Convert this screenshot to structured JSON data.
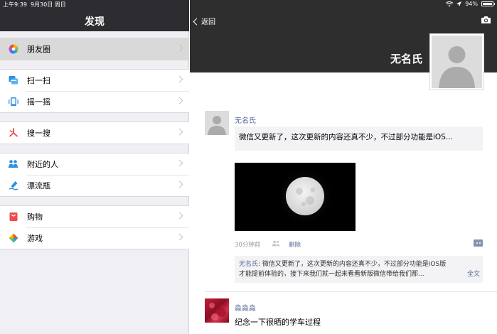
{
  "status_bar": {
    "time": "上午9:39",
    "date": "9月30日 周日",
    "battery": "94%"
  },
  "left_panel": {
    "title": "发现",
    "groups": [
      [
        {
          "label": "朋友圈",
          "icon": "moments-icon",
          "selected": true
        }
      ],
      [
        {
          "label": "扫一扫",
          "icon": "scan-icon"
        },
        {
          "label": "摇一摇",
          "icon": "shake-icon"
        }
      ],
      [
        {
          "label": "搜一搜",
          "icon": "search-icon"
        }
      ],
      [
        {
          "label": "附近的人",
          "icon": "people-nearby-icon"
        },
        {
          "label": "漂流瓶",
          "icon": "drift-bottle-icon"
        }
      ],
      [
        {
          "label": "购物",
          "icon": "shopping-icon"
        },
        {
          "label": "游戏",
          "icon": "games-icon"
        }
      ]
    ]
  },
  "right_panel": {
    "back_label": "返回",
    "owner_name": "无名氏",
    "post": {
      "author": "无名氏",
      "text": "微信又更新了，这次更新的内容还真不少，不过部分功能是iOS...",
      "time": "30分钟前",
      "delete_label": "删除",
      "share": {
        "name": "无名氏",
        "line1": ": 微信又更新了，这次更新的内容还真不少，不过部分功能是iOS版",
        "line2": "才能提前体验的，接下来我们就一起来看看新版微信带给我们那...",
        "full_label": "全文"
      }
    },
    "post2": {
      "author": "淼淼淼",
      "text": "纪念一下很晒的学车过程"
    }
  },
  "colors": {
    "header_bg": "#2c2c31",
    "cover_bg": "#2e2e2e",
    "link": "#576b95",
    "panel_bg": "#efeff4"
  }
}
